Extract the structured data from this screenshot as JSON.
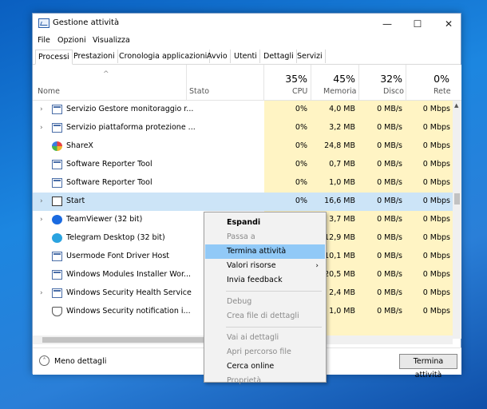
{
  "window": {
    "title": "Gestione attività",
    "controls": {
      "minimize": "—",
      "maximize": "☐",
      "close": "✕"
    }
  },
  "menu": [
    "File",
    "Opzioni",
    "Visualizza"
  ],
  "tabs": [
    "Processi",
    "Prestazioni",
    "Cronologia applicazioni",
    "Avvio",
    "Utenti",
    "Dettagli",
    "Servizi"
  ],
  "active_tab": "Processi",
  "columns": {
    "name": "Nome",
    "status": "Stato",
    "cpu": {
      "pct": "35%",
      "label": "CPU"
    },
    "memory": {
      "pct": "45%",
      "label": "Memoria"
    },
    "disk": {
      "pct": "32%",
      "label": "Disco"
    },
    "network": {
      "pct": "0%",
      "label": "Rete"
    }
  },
  "rows": [
    {
      "expand": "›",
      "icon": "service-icon",
      "name": "Servizio Gestore monitoraggio r...",
      "cpu": "0%",
      "mem": "4,0 MB",
      "disk": "0 MB/s",
      "net": "0 Mbps"
    },
    {
      "expand": "›",
      "icon": "service-icon",
      "name": "Servizio piattaforma protezione ...",
      "cpu": "0%",
      "mem": "3,2 MB",
      "disk": "0 MB/s",
      "net": "0 Mbps"
    },
    {
      "expand": "",
      "icon": "sharex-icon",
      "name": "ShareX",
      "cpu": "0%",
      "mem": "24,8 MB",
      "disk": "0 MB/s",
      "net": "0 Mbps"
    },
    {
      "expand": "",
      "icon": "app-window-icon",
      "name": "Software Reporter Tool",
      "cpu": "0%",
      "mem": "0,7 MB",
      "disk": "0 MB/s",
      "net": "0 Mbps"
    },
    {
      "expand": "",
      "icon": "app-window-icon",
      "name": "Software Reporter Tool",
      "cpu": "0%",
      "mem": "1,0 MB",
      "disk": "0 MB/s",
      "net": "0 Mbps"
    },
    {
      "expand": "›",
      "icon": "start-icon",
      "name": "Start",
      "cpu": "0%",
      "mem": "16,6 MB",
      "disk": "0 MB/s",
      "net": "0 Mbps",
      "selected": true
    },
    {
      "expand": "›",
      "icon": "teamviewer-icon",
      "name": "TeamViewer (32 bit)",
      "cpu": "",
      "mem": "3,7 MB",
      "disk": "0 MB/s",
      "net": "0 Mbps"
    },
    {
      "expand": "",
      "icon": "telegram-icon",
      "name": "Telegram Desktop (32 bit)",
      "cpu": "",
      "mem": "12,9 MB",
      "disk": "0 MB/s",
      "net": "0 Mbps"
    },
    {
      "expand": "",
      "icon": "app-window-icon",
      "name": "Usermode Font Driver Host",
      "cpu": "",
      "mem": "10,1 MB",
      "disk": "0 MB/s",
      "net": "0 Mbps"
    },
    {
      "expand": "",
      "icon": "app-window-icon",
      "name": "Windows Modules Installer Wor...",
      "cpu": "",
      "mem": "20,5 MB",
      "disk": "0 MB/s",
      "net": "0 Mbps"
    },
    {
      "expand": "›",
      "icon": "service-icon",
      "name": "Windows Security Health Service",
      "cpu": "",
      "mem": "2,4 MB",
      "disk": "0 MB/s",
      "net": "0 Mbps"
    },
    {
      "expand": "",
      "icon": "shield-icon",
      "name": "Windows Security notification i...",
      "cpu": "",
      "mem": "1,0 MB",
      "disk": "0 MB/s",
      "net": "0 Mbps"
    }
  ],
  "footer": {
    "less_details": "Meno dettagli",
    "end_task": "Termina attività"
  },
  "context_menu": [
    {
      "label": "Espandi",
      "bold": true
    },
    {
      "label": "Passa a",
      "disabled": true
    },
    {
      "label": "Termina attività",
      "hover": true
    },
    {
      "label": "Valori risorse",
      "submenu": "›"
    },
    {
      "label": "Invia feedback"
    },
    {
      "sep": true
    },
    {
      "label": "Debug",
      "disabled": true
    },
    {
      "label": "Crea file di dettagli",
      "disabled": true
    },
    {
      "sep": true
    },
    {
      "label": "Vai ai dettagli",
      "disabled": true
    },
    {
      "label": "Apri percorso file",
      "disabled": true
    },
    {
      "label": "Cerca online"
    },
    {
      "label": "Proprietà",
      "disabled": true
    }
  ],
  "colors": {
    "metric_bg": "#fff4c4",
    "selected_row": "#cce4f7",
    "menu_hover": "#91c9f7"
  }
}
